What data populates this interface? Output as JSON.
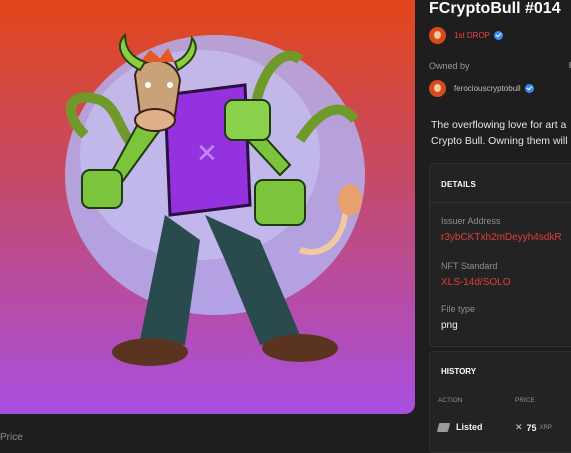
{
  "nft": {
    "title": "FCryptoBull #014",
    "collection": "1st DROP",
    "owned_label": "Owned by",
    "owner": "ferociouscryptobull",
    "description_lines": [
      "The overflowing love for art a",
      "Crypto Bull. Owning them will"
    ]
  },
  "details": {
    "heading": "DETAILS",
    "issuer_label": "Issuer Address",
    "issuer_value": "r3ybCKTxh2mDeyyh4sdkR",
    "standard_label": "NFT Standard",
    "standard_value": "XLS-14d/SOLO",
    "filetype_label": "File type",
    "filetype_value": "png"
  },
  "history": {
    "heading": "HISTORY",
    "columns": [
      "ACTION",
      "PRICE"
    ],
    "rows": [
      {
        "action": "Listed",
        "price": "75",
        "unit": "XRP"
      }
    ]
  },
  "footer": {
    "price_label": "Price"
  },
  "colors": {
    "background": "#1e1e1e",
    "accent_red": "#e23d3d",
    "verified_blue": "#3a8cf0"
  },
  "icons": [
    "verified-badge-icon",
    "xrp-icon",
    "tag-icon"
  ]
}
